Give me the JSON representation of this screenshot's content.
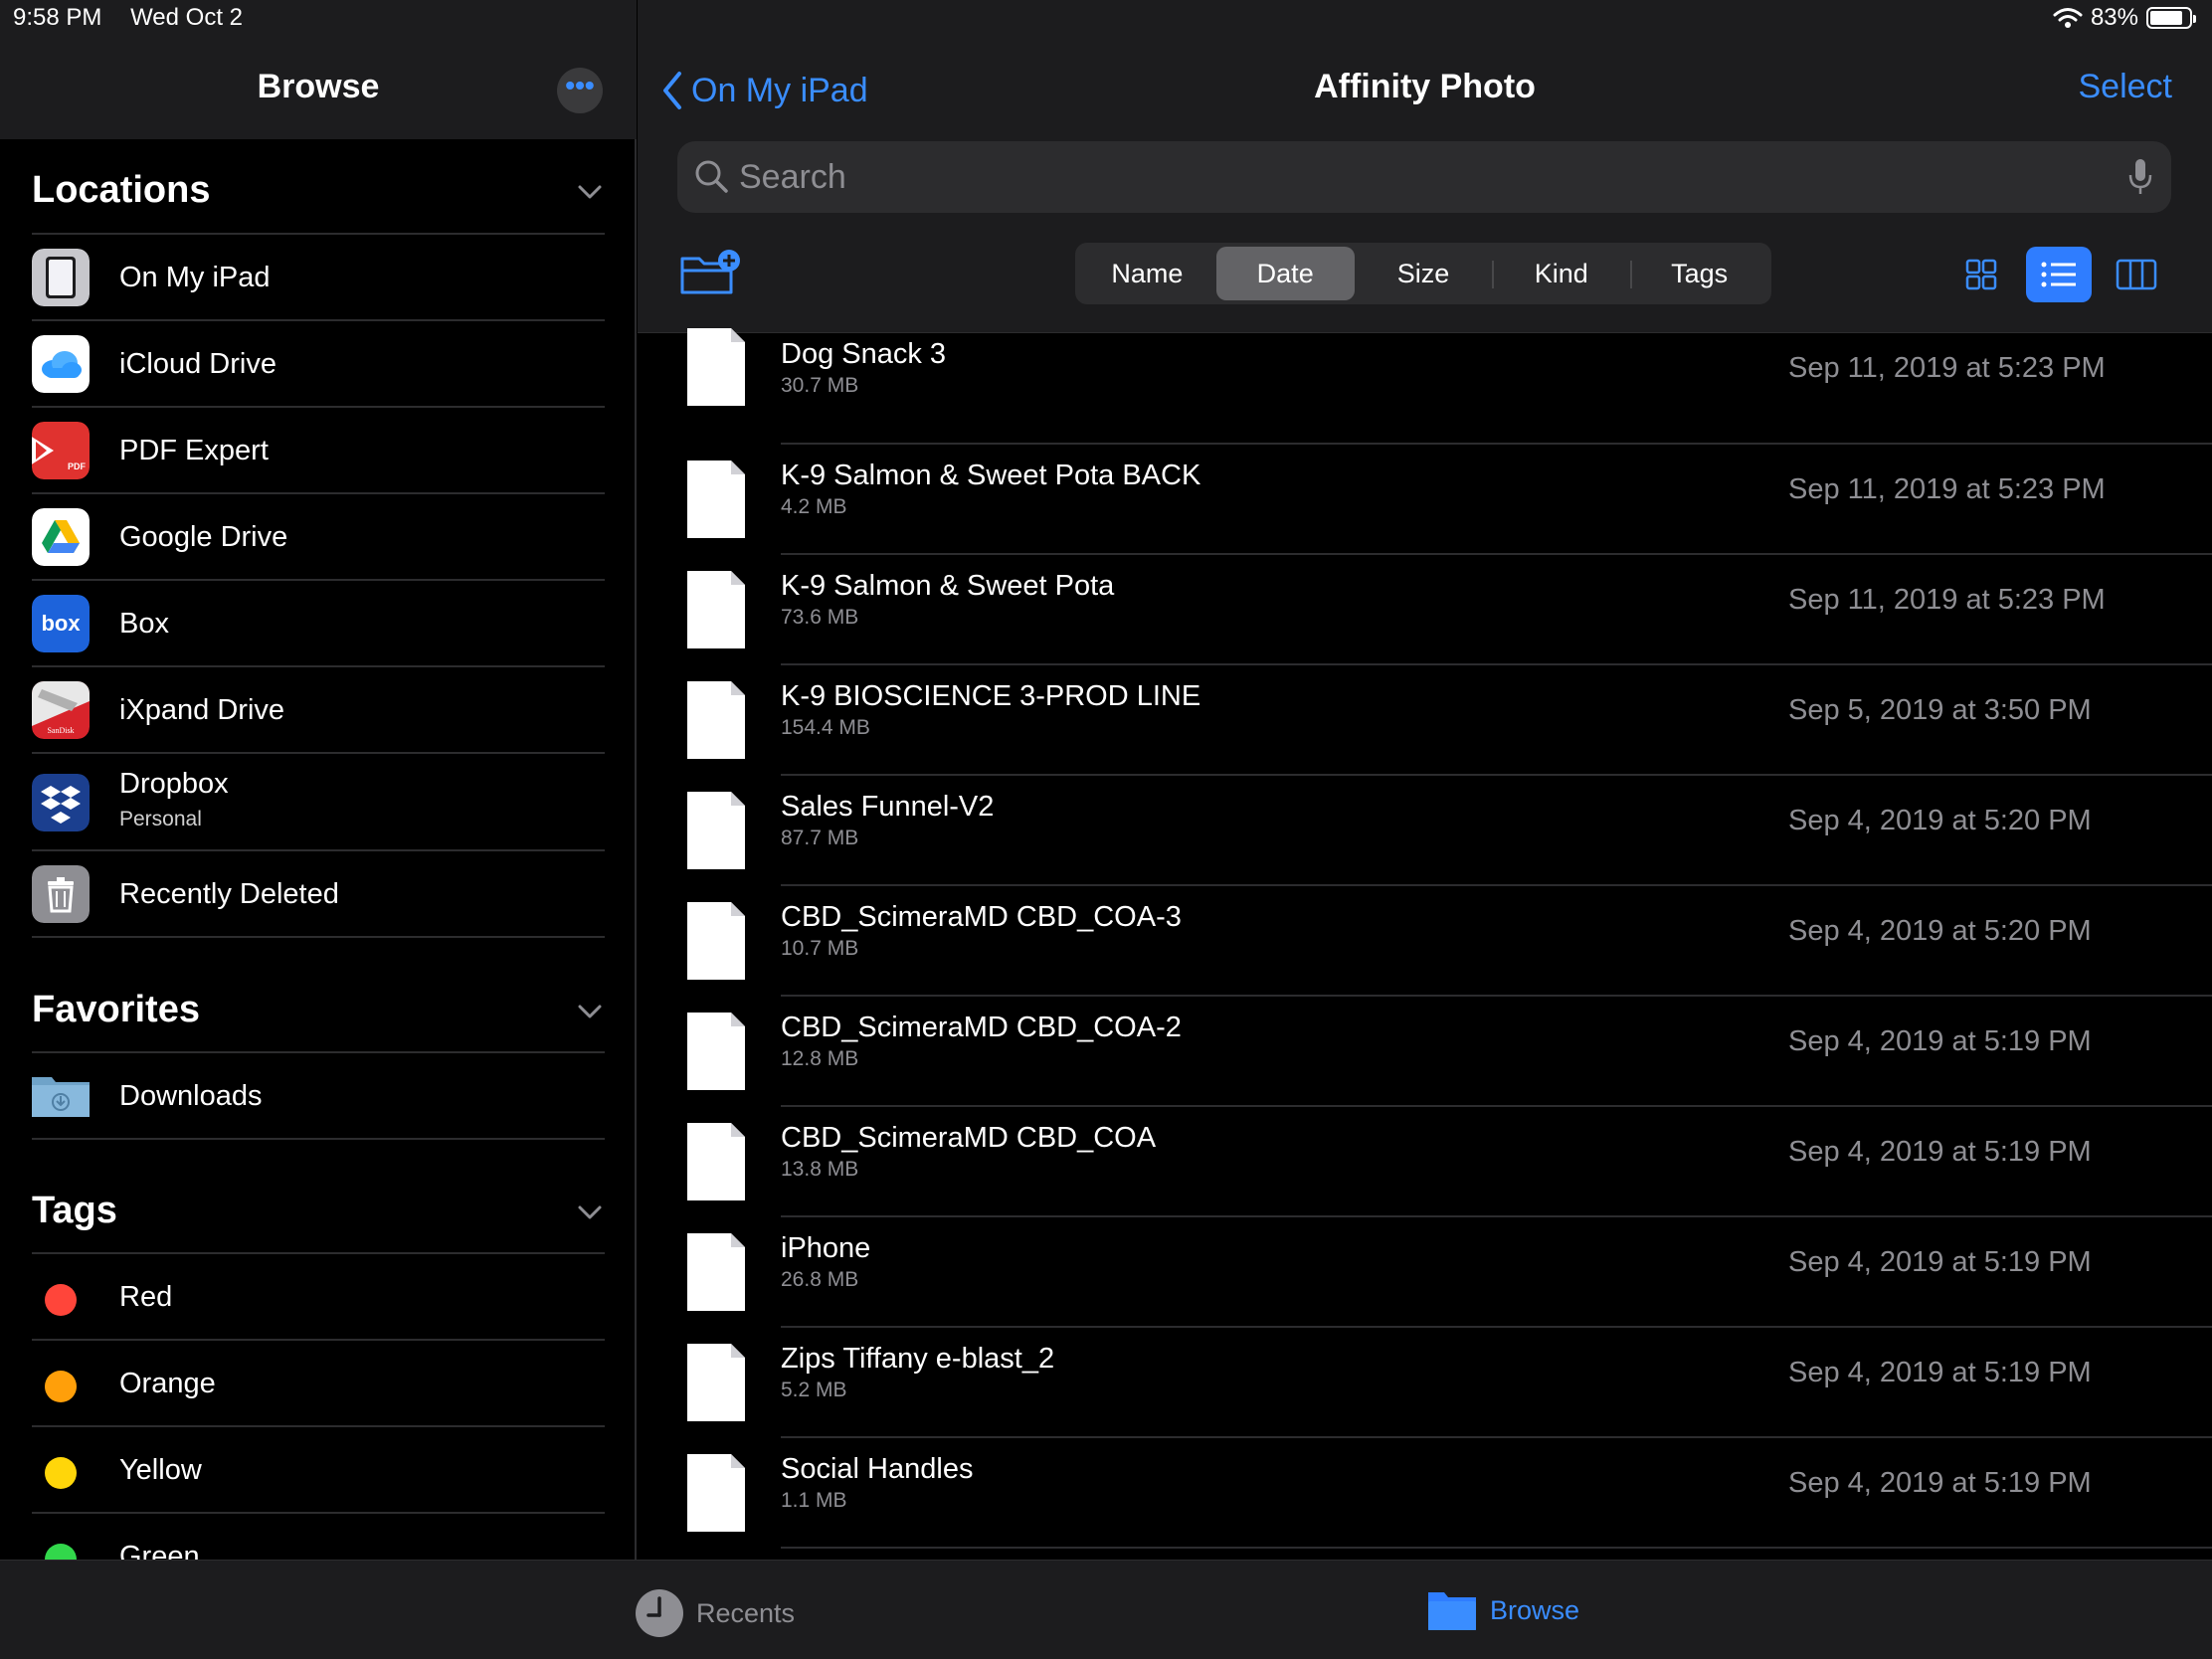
{
  "status_bar": {
    "time": "9:58 PM",
    "date": "Wed Oct 2",
    "battery_percent": "83%",
    "battery_level": 0.83
  },
  "sidebar": {
    "title": "Browse",
    "more_label": "•••",
    "locations": {
      "title": "Locations",
      "items": [
        {
          "label": "On My iPad",
          "icon": "ipad-icon"
        },
        {
          "label": "iCloud Drive",
          "icon": "icloud-icon"
        },
        {
          "label": "PDF Expert",
          "icon": "pdf-expert-icon",
          "icon_text": "PDF"
        },
        {
          "label": "Google Drive",
          "icon": "google-drive-icon"
        },
        {
          "label": "Box",
          "icon": "box-icon",
          "icon_text": "box"
        },
        {
          "label": "iXpand Drive",
          "icon": "ixpand-icon",
          "icon_text": "SanDisk"
        },
        {
          "label": "Dropbox",
          "sublabel": "Personal",
          "icon": "dropbox-icon"
        },
        {
          "label": "Recently Deleted",
          "icon": "trash-icon"
        }
      ]
    },
    "favorites": {
      "title": "Favorites",
      "items": [
        {
          "label": "Downloads",
          "icon": "downloads-folder-icon"
        }
      ]
    },
    "tags": {
      "title": "Tags",
      "items": [
        {
          "label": "Red",
          "color": "#ff453a"
        },
        {
          "label": "Orange",
          "color": "#ff9f0a"
        },
        {
          "label": "Yellow",
          "color": "#ffd60a"
        },
        {
          "label": "Green",
          "color": "#32d74b"
        }
      ]
    }
  },
  "main": {
    "back_label": "On My iPad",
    "title": "Affinity Photo",
    "select_label": "Select",
    "search": {
      "placeholder": "Search"
    },
    "sort_options": [
      "Name",
      "Date",
      "Size",
      "Kind",
      "Tags"
    ],
    "sort_selected": "Date",
    "view_modes": [
      "icon-view",
      "list-view",
      "column-view"
    ],
    "view_selected": "list-view",
    "files": [
      {
        "name": "Dog Snack 3",
        "size": "30.7 MB",
        "date": "Sep 11, 2019 at 5:23 PM"
      },
      {
        "name": "K-9 Salmon & Sweet Pota BACK",
        "size": "4.2 MB",
        "date": "Sep 11, 2019 at 5:23 PM"
      },
      {
        "name": "K-9 Salmon & Sweet Pota",
        "size": "73.6 MB",
        "date": "Sep 11, 2019 at 5:23 PM"
      },
      {
        "name": "K-9 BIOSCIENCE 3-PROD LINE",
        "size": "154.4 MB",
        "date": "Sep 5, 2019 at 3:50 PM"
      },
      {
        "name": "Sales Funnel-V2",
        "size": "87.7 MB",
        "date": "Sep 4, 2019 at 5:20 PM"
      },
      {
        "name": "CBD_ScimeraMD CBD_COA-3",
        "size": "10.7 MB",
        "date": "Sep 4, 2019 at 5:20 PM"
      },
      {
        "name": "CBD_ScimeraMD CBD_COA-2",
        "size": "12.8 MB",
        "date": "Sep 4, 2019 at 5:19 PM"
      },
      {
        "name": "CBD_ScimeraMD CBD_COA",
        "size": "13.8 MB",
        "date": "Sep 4, 2019 at 5:19 PM"
      },
      {
        "name": "iPhone",
        "size": "26.8 MB",
        "date": "Sep 4, 2019 at 5:19 PM"
      },
      {
        "name": "Zips Tiffany e-blast_2",
        "size": "5.2 MB",
        "date": "Sep 4, 2019 at 5:19 PM"
      },
      {
        "name": "Social Handles",
        "size": "1.1 MB",
        "date": "Sep 4, 2019 at 5:19 PM"
      }
    ]
  },
  "tab_bar": {
    "recents_label": "Recents",
    "browse_label": "Browse",
    "selected": "Browse"
  },
  "colors": {
    "accent": "#3a8dff",
    "background": "#000000",
    "header_background": "#1c1c1e"
  }
}
